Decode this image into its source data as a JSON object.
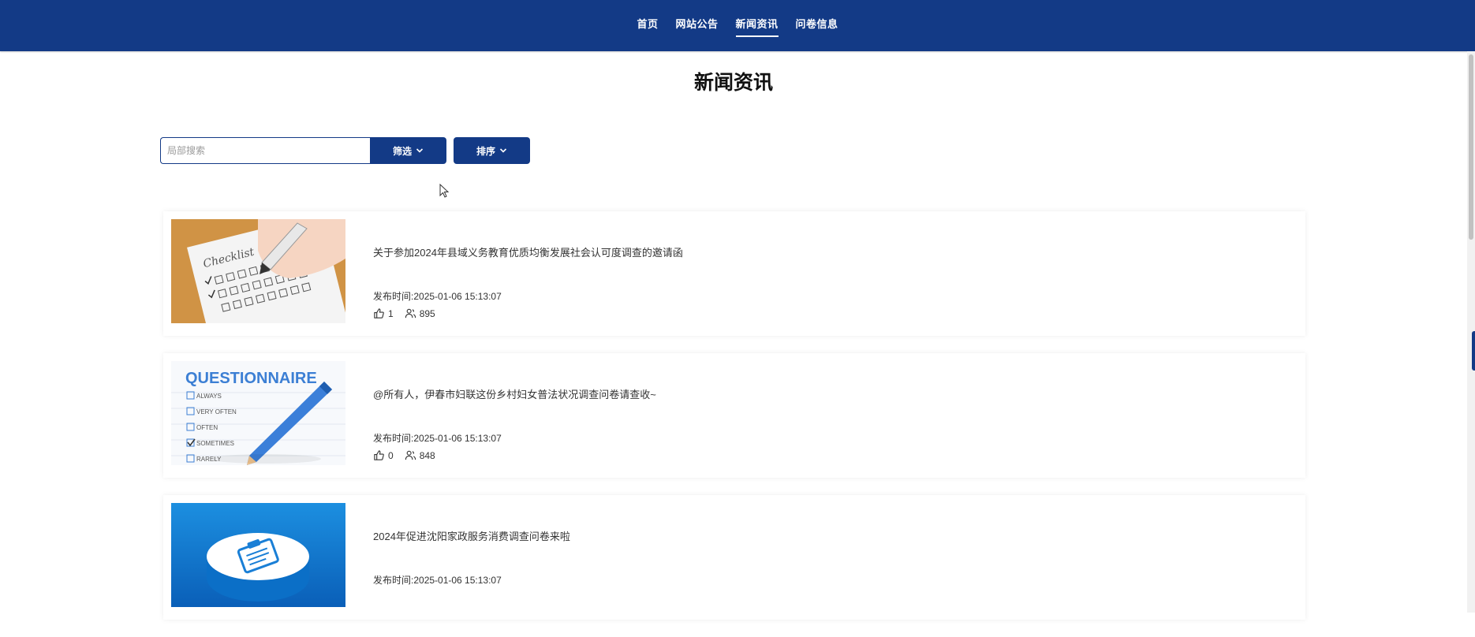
{
  "nav": {
    "items": [
      {
        "label": "首页",
        "active": false
      },
      {
        "label": "网站公告",
        "active": false
      },
      {
        "label": "新闻资讯",
        "active": true
      },
      {
        "label": "问卷信息",
        "active": false
      }
    ]
  },
  "page": {
    "title": "新闻资讯"
  },
  "search": {
    "placeholder": "局部搜索",
    "value": "",
    "filter_label": "筛选",
    "sort_label": "排序"
  },
  "news": [
    {
      "title": "关于参加2024年县域义务教育优质均衡发展社会认可度调查的邀请函",
      "date_label": "发布时间:",
      "date": "2025-01-06 15:13:07",
      "likes": "1",
      "views": "895",
      "image": "checklist-photo"
    },
    {
      "title": "@所有人，伊春市妇联这份乡村妇女普法状况调查问卷请查收~",
      "date_label": "发布时间:",
      "date": "2025-01-06 15:13:07",
      "likes": "0",
      "views": "848",
      "image": "questionnaire-illustration",
      "image_text": {
        "heading": "QUESTIONNAIRE",
        "options": [
          "ALWAYS",
          "VERY OFTEN",
          "OFTEN",
          "SOMETIMES",
          "RARELY"
        ]
      }
    },
    {
      "title": "2024年促进沈阳家政服务消费调查问卷来啦",
      "date_label": "发布时间:",
      "date": "2025-01-06 15:13:07",
      "likes": "",
      "views": "",
      "image": "clipboard-3d-illustration"
    }
  ],
  "colors": {
    "primary": "#133a86",
    "text": "#333333"
  },
  "icons": {
    "like": "thumbs-up-icon",
    "views": "users-icon",
    "dropdown": "chevron-down-icon"
  }
}
